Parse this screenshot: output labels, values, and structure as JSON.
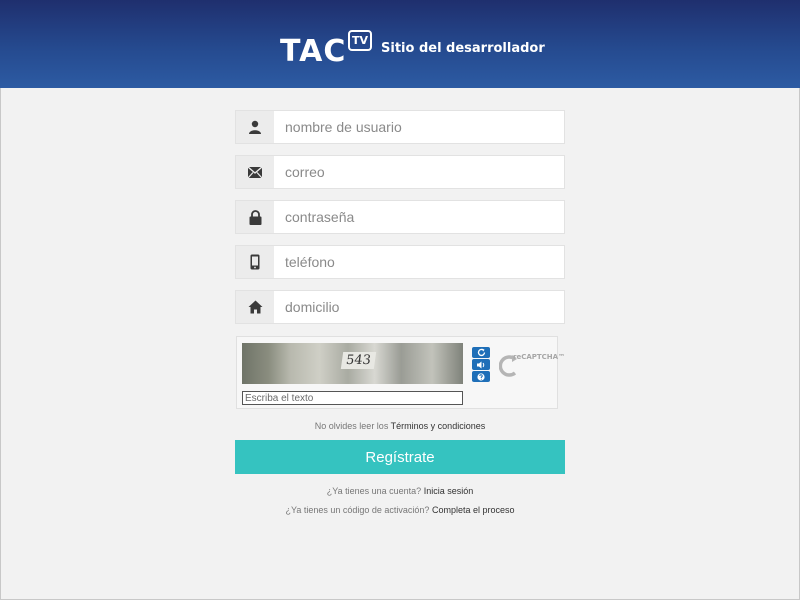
{
  "header": {
    "logo_main": "TAC",
    "logo_badge": "TV",
    "title": "Sitio del desarrollador",
    "background_color": "#254a8f"
  },
  "form": {
    "fields": [
      {
        "icon": "user-icon",
        "placeholder": "nombre de usuario",
        "value": ""
      },
      {
        "icon": "envelope-icon",
        "placeholder": "correo",
        "value": ""
      },
      {
        "icon": "lock-icon",
        "placeholder": "contraseña",
        "value": ""
      },
      {
        "icon": "phone-icon",
        "placeholder": "teléfono",
        "value": ""
      },
      {
        "icon": "home-icon",
        "placeholder": "domicilio",
        "value": ""
      }
    ]
  },
  "captcha": {
    "image_text": "543",
    "input_placeholder": "Escriba el texto",
    "input_value": "",
    "buttons": [
      "refresh-icon",
      "audio-icon",
      "help-icon"
    ],
    "brand": "reCAPTCHA™"
  },
  "terms": {
    "text": "No olvides leer los",
    "link": "Términos y condiciones"
  },
  "register_button": {
    "label": "Regístrate",
    "color": "#35c3c0"
  },
  "account_prompt": {
    "text": "¿Ya tienes una cuenta?",
    "link": "Inicia sesión"
  },
  "activation_prompt": {
    "text": "¿Ya tienes un código de activación?",
    "link": "Completa el proceso"
  }
}
